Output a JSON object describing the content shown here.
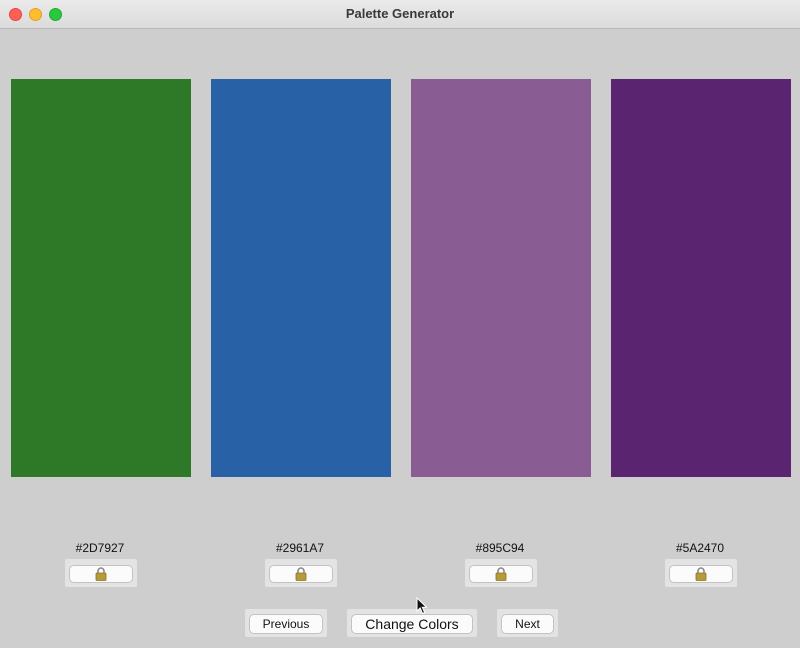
{
  "window": {
    "title": "Palette Generator"
  },
  "palette": [
    {
      "hex": "#2D7927",
      "color": "#2d7927"
    },
    {
      "hex": "#2961A7",
      "color": "#2961a7"
    },
    {
      "hex": "#895C94",
      "color": "#895c94"
    },
    {
      "hex": "#5A2470",
      "color": "#5a2470"
    }
  ],
  "lock_icon": "lock-icon",
  "controls": {
    "previous_label": "Previous",
    "change_label": "Change Colors",
    "next_label": "Next"
  }
}
